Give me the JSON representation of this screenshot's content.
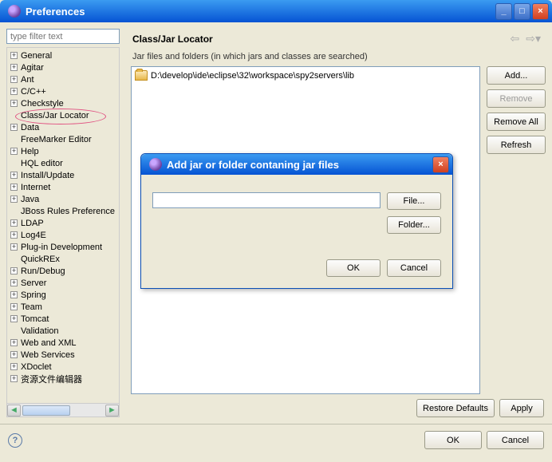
{
  "window": {
    "title": "Preferences",
    "min_label": "_",
    "max_label": "□",
    "close_label": "×"
  },
  "filter": {
    "placeholder": "type filter text"
  },
  "tree": {
    "items": [
      {
        "label": "General",
        "exp": "+",
        "indent": false
      },
      {
        "label": "Agitar",
        "exp": "+",
        "indent": false
      },
      {
        "label": "Ant",
        "exp": "+",
        "indent": false
      },
      {
        "label": "C/C++",
        "exp": "+",
        "indent": false
      },
      {
        "label": "Checkstyle",
        "exp": "+",
        "indent": false
      },
      {
        "label": "Class/Jar Locator",
        "exp": "",
        "indent": true,
        "hl": true
      },
      {
        "label": "Data",
        "exp": "+",
        "indent": false
      },
      {
        "label": "FreeMarker Editor",
        "exp": "",
        "indent": true
      },
      {
        "label": "Help",
        "exp": "+",
        "indent": false
      },
      {
        "label": "HQL editor",
        "exp": "",
        "indent": true
      },
      {
        "label": "Install/Update",
        "exp": "+",
        "indent": false
      },
      {
        "label": "Internet",
        "exp": "+",
        "indent": false
      },
      {
        "label": "Java",
        "exp": "+",
        "indent": false
      },
      {
        "label": "JBoss Rules Preference",
        "exp": "",
        "indent": true
      },
      {
        "label": "LDAP",
        "exp": "+",
        "indent": false
      },
      {
        "label": "Log4E",
        "exp": "+",
        "indent": false
      },
      {
        "label": "Plug-in Development",
        "exp": "+",
        "indent": false
      },
      {
        "label": "QuickREx",
        "exp": "",
        "indent": true
      },
      {
        "label": "Run/Debug",
        "exp": "+",
        "indent": false
      },
      {
        "label": "Server",
        "exp": "+",
        "indent": false
      },
      {
        "label": "Spring",
        "exp": "+",
        "indent": false
      },
      {
        "label": "Team",
        "exp": "+",
        "indent": false
      },
      {
        "label": "Tomcat",
        "exp": "+",
        "indent": false
      },
      {
        "label": "Validation",
        "exp": "",
        "indent": true
      },
      {
        "label": "Web and XML",
        "exp": "+",
        "indent": false
      },
      {
        "label": "Web Services",
        "exp": "+",
        "indent": false
      },
      {
        "label": "XDoclet",
        "exp": "+",
        "indent": false
      },
      {
        "label": "资源文件编辑器",
        "exp": "+",
        "indent": false
      }
    ]
  },
  "page": {
    "title": "Class/Jar Locator",
    "desc": "Jar files and folders (in which jars and classes are searched)",
    "list_item": "D:\\develop\\ide\\eclipse\\32\\workspace\\spy2servers\\lib",
    "add": "Add...",
    "remove": "Remove",
    "remove_all": "Remove All",
    "refresh": "Refresh",
    "restore": "Restore Defaults",
    "apply": "Apply"
  },
  "footer": {
    "ok": "OK",
    "cancel": "Cancel"
  },
  "dialog": {
    "title": "Add jar or folder contaning jar files",
    "close": "×",
    "input_value": "",
    "file": "File...",
    "folder": "Folder...",
    "ok": "OK",
    "cancel": "Cancel"
  }
}
